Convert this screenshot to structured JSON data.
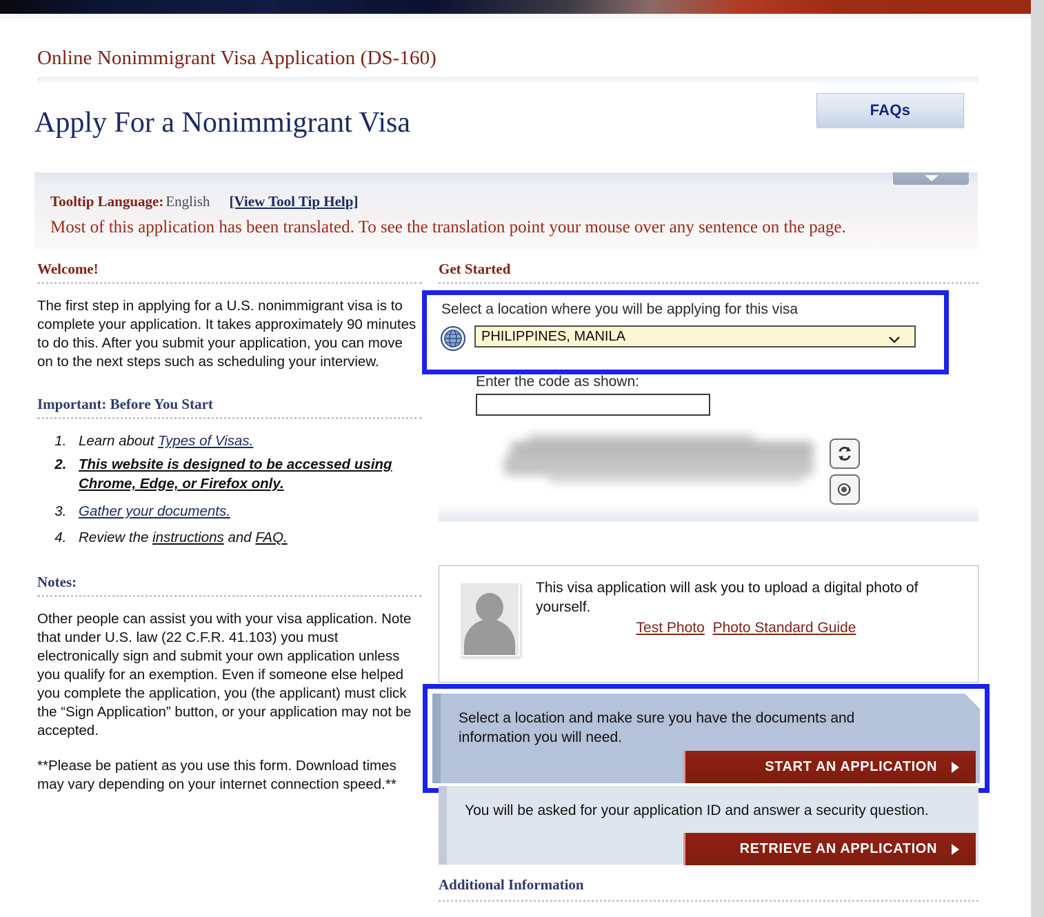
{
  "header": {
    "site_title": "Online Nonimmigrant Visa Application (DS-160)",
    "page_title": "Apply For a Nonimmigrant Visa",
    "faqs_button": "FAQs"
  },
  "tooltip_band": {
    "label": "Tooltip Language:",
    "language": "English",
    "help_link": "[View Tool Tip Help]",
    "note": "Most of this application has been translated. To see the translation point your mouse over any sentence on the page."
  },
  "left_column": {
    "welcome_heading": "Welcome!",
    "welcome_text": "The first step in applying for a U.S. nonimmigrant visa is to complete your application. It takes approximately 90 minutes to do this. After you submit your application, you can move on to the next steps such as scheduling your interview.",
    "important_heading": "Important: Before You Start",
    "steps": [
      {
        "prefix": "Learn about ",
        "link": "Types of Visas.",
        "suffix": ""
      },
      {
        "bold_text": "This website is designed to be accessed using Chrome, Edge, or Firefox only."
      },
      {
        "prefix": "",
        "link": "Gather your documents.",
        "suffix": ""
      },
      {
        "prefix": "Review the ",
        "link": "instructions",
        "middle": " and ",
        "link2": "FAQ.",
        "suffix": ""
      }
    ],
    "notes_heading": "Notes:",
    "notes_text": "Other people can assist you with your visa application. Note that under U.S. law (22 C.F.R. 41.103) you must electronically sign and submit your own application unless you qualify for an exemption. Even if someone else helped you complete the application, you (the applicant) must click the “Sign Application” button, or your application may not be accepted.",
    "notes_text2": "**Please be patient as you use this form. Download times may vary depending on your internet connection speed.**"
  },
  "right_column": {
    "get_started_heading": "Get Started",
    "location_label": "Select a location where you will be applying for this visa",
    "location_selected": "PHILIPPINES, MANILA",
    "code_label": "Enter the code as shown:",
    "code_value": "",
    "code_placeholder": "",
    "photo_text": "This visa application will ask you to upload a digital photo of yourself.",
    "photo_link_1": "Test Photo",
    "photo_link_2": "Photo Standard Guide",
    "start_text": "Select a location and make sure you have the documents and information you will need.",
    "start_button": "START AN APPLICATION",
    "retrieve_text": "You will be asked for your application ID and answer a security question.",
    "retrieve_button": "RETRIEVE AN APPLICATION",
    "additional_information_heading": "Additional Information"
  },
  "colors": {
    "highlight_outline": "#1a23e8",
    "site_title_red": "#7e2217",
    "page_title_blue": "#1b2a63",
    "cta_red": "#8f2214",
    "select_yellow": "#fcf8d4"
  }
}
